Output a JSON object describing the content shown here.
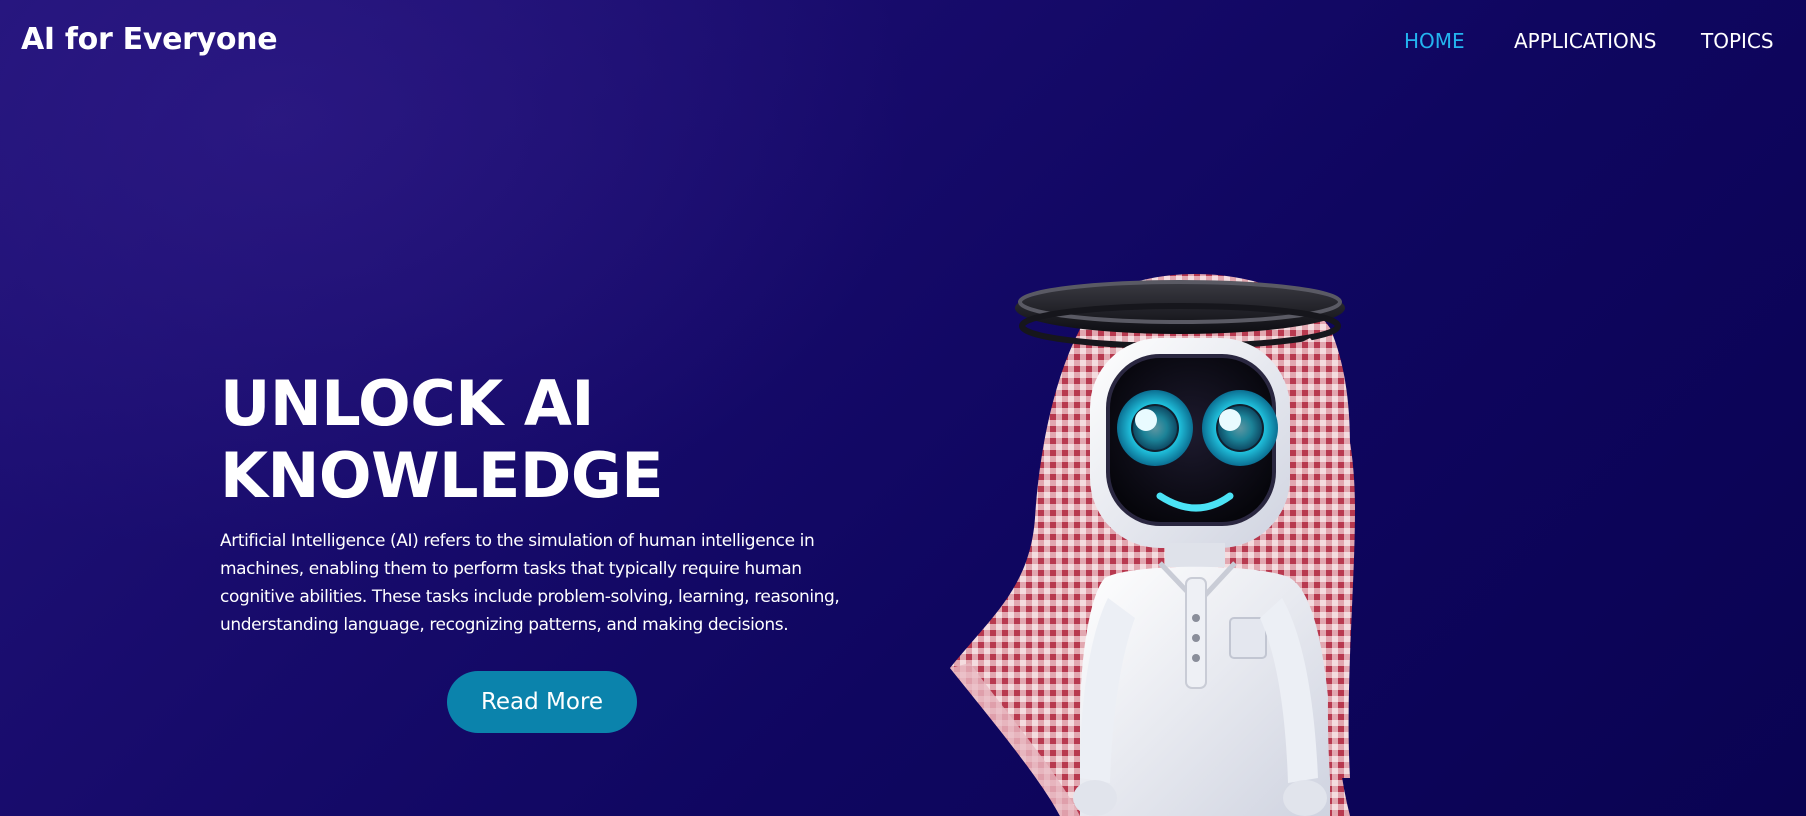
{
  "header": {
    "logo": "AI for Everyone",
    "nav": [
      {
        "label": "HOME",
        "active": true
      },
      {
        "label": "APPLICATIONS",
        "active": false
      },
      {
        "label": "TOPICS",
        "active": false
      }
    ]
  },
  "hero": {
    "title_line1": "UNLOCK AI",
    "title_line2": "KNOWLEDGE",
    "description": "Artificial Intelligence (AI) refers to the simulation of human intelligence in machines, enabling them to perform tasks that typically require human cognitive abilities. These tasks include problem-solving, learning, reasoning, understanding language, recognizing patterns, and making decisions.",
    "button": "Read More"
  },
  "illustration": {
    "icon": "robot-mascot-icon"
  },
  "colors": {
    "background": "#14096a",
    "nav_active": "#23b4f0",
    "button": "#0b83ac",
    "text": "#ffffff"
  }
}
